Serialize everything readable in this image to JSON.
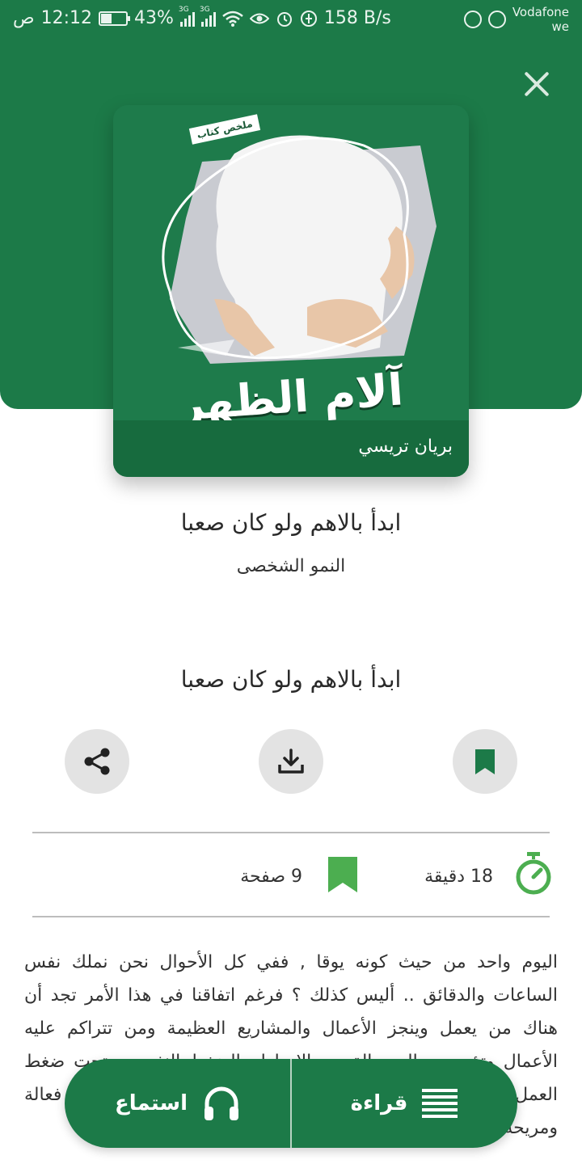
{
  "status_bar": {
    "time": "12:12",
    "am_pm": "ص",
    "battery": "43%",
    "battery_level": 0.43,
    "network_1": "3G",
    "network_2": "3G",
    "speed": "158 B/s",
    "carrier_line1": "Vodafone",
    "carrier_line2": "we"
  },
  "cover": {
    "tag": "ملخص كتاب",
    "title": "آلام الظهر",
    "author": "بريان تريسي"
  },
  "book": {
    "title": "ابدأ بالاهم ولو كان صعبا",
    "category": "النمو الشخصى"
  },
  "section": {
    "title": "ابدأ بالاهم ولو كان صعبا"
  },
  "stats": {
    "duration": "18 دقيقة",
    "pages": "9 صفحة"
  },
  "description": "اليوم واحد من حيث كونه يوقا , ففي كل الأحوال نحن نملك نفس الساعات والدقائق .. أليس كذلك ؟ فرغم اتفاقنا في هذا الأمر تجد أن هناك من يعمل وينجز الأعمال والمشاريع العظيمة ومن تتراكم عليه الأعمال وتؤدي به إلى حالة من الإحباط والضغط النفسي وتحت ضغط العمل والوقت تجد من يبحث عن حلول لإدارة الوقت بطريقة فعالة ومريحة",
  "bottom_bar": {
    "read_label": "قراءة",
    "listen_label": "استماع"
  },
  "colors": {
    "primary": "#1c7a48",
    "accent_green": "#4cae50",
    "button_bg": "#e3e3e3"
  }
}
